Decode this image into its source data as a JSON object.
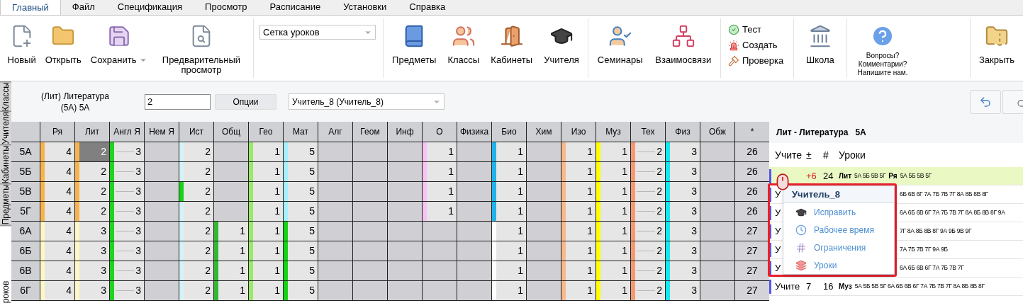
{
  "menu": [
    {
      "label": "Главный",
      "selected": true
    },
    {
      "label": "Файл",
      "selected": false
    },
    {
      "label": "Спецификация",
      "selected": false
    },
    {
      "label": "Просмотр",
      "selected": false
    },
    {
      "label": "Расписание",
      "selected": false
    },
    {
      "label": "Установки",
      "selected": false
    },
    {
      "label": "Справка",
      "selected": false
    }
  ],
  "ribbon": [
    {
      "kind": "buttons",
      "items": [
        {
          "label": "Новый",
          "dropdown": false
        },
        {
          "label": "Открыть",
          "dropdown": false
        },
        {
          "label": "Сохранить",
          "dropdown": true
        },
        {
          "label": "Предварительный просмотр",
          "dropdown": false
        }
      ]
    },
    {
      "kind": "select",
      "value": "Сетка уроков"
    },
    {
      "kind": "buttons",
      "items": [
        {
          "label": "Предметы",
          "dropdown": false
        },
        {
          "label": "Классы",
          "dropdown": false
        },
        {
          "label": "Кабинеты",
          "dropdown": false
        },
        {
          "label": "Учителя",
          "dropdown": false
        }
      ]
    },
    {
      "kind": "buttons",
      "items": [
        {
          "label": "Семинары",
          "dropdown": false
        },
        {
          "label": "Взаимосвязи",
          "dropdown": false
        }
      ]
    },
    {
      "kind": "list",
      "items": [
        {
          "label": "Тест"
        },
        {
          "label": "Создать"
        },
        {
          "label": "Проверка"
        }
      ]
    },
    {
      "kind": "buttons",
      "items": [
        {
          "label": "Школа",
          "dropdown": false
        }
      ]
    },
    {
      "kind": "note",
      "lines": [
        "Вопросы?",
        "Комментарии?",
        "Напишите нам."
      ]
    },
    {
      "kind": "buttons",
      "items": [
        {
          "label": "Закрыть",
          "dropdown": false
        }
      ]
    }
  ],
  "side_tabs": [
    {
      "label": "Классы",
      "selected": false
    },
    {
      "label": "Учителя",
      "selected": false
    },
    {
      "label": "Кабинеты",
      "selected": false
    },
    {
      "label": "Предметы",
      "selected": false
    },
    {
      "label": "роков",
      "selected": true
    }
  ],
  "options_bar": {
    "subject": "(Лит) Литература",
    "class": "(5А) 5А",
    "count": "2",
    "options_button": "Опции",
    "teacher": "Учитель_8 (Учитель_8)"
  },
  "grid": {
    "columns": [
      "Ря",
      "Лит",
      "Англ Я",
      "Нем Я",
      "Ист",
      "Общ",
      "Гео",
      "Мат",
      "Алг",
      "Геом",
      "Инф",
      "О",
      "Физика",
      "Био",
      "Хим",
      "Изо",
      "Муз",
      "Тех",
      "Физ",
      "Обж",
      "*"
    ],
    "rows": [
      {
        "label": "5А",
        "total": "26",
        "cells": [
          {
            "value": "4",
            "color": "#f7b44c",
            "linked": false,
            "selected": false
          },
          {
            "value": "2",
            "color": "#f7b44c",
            "linked": false,
            "selected": true
          },
          {
            "value": "3",
            "color": "#1ed41e",
            "linked": true,
            "selected": false
          },
          {
            "selected": false
          },
          {
            "value": "2",
            "color": "#d4f3f7",
            "linked": false,
            "selected": false
          },
          {
            "selected": false
          },
          {
            "value": "1",
            "color": "#9be86a",
            "linked": false,
            "selected": false
          },
          {
            "value": "5",
            "color": "#a6f0fa",
            "linked": false,
            "selected": false
          },
          {
            "selected": false
          },
          {
            "selected": false
          },
          {
            "selected": false
          },
          {
            "value": "1",
            "color": "#f7c3f2",
            "linked": false,
            "selected": false
          },
          {
            "selected": false
          },
          {
            "value": "1",
            "color": "#1fb3e8",
            "linked": false,
            "selected": false
          },
          {
            "selected": false
          },
          {
            "value": "1",
            "color": "#f8b98f",
            "linked": false,
            "selected": false
          },
          {
            "value": "1",
            "color": "#ffff00",
            "linked": false,
            "selected": false
          },
          {
            "value": "2",
            "color": "#f59a70",
            "linked": true,
            "selected": false
          },
          {
            "value": "3",
            "color": "#14e8ee",
            "linked": false,
            "selected": false
          },
          {
            "selected": false
          }
        ]
      },
      {
        "label": "5Б",
        "total": "26",
        "cells": [
          {
            "value": "4",
            "color": "#f7b44c",
            "linked": false,
            "selected": false
          },
          {
            "value": "2",
            "color": "#f7b44c",
            "linked": false,
            "selected": false
          },
          {
            "value": "3",
            "color": "#1ed41e",
            "linked": true,
            "selected": false
          },
          {
            "selected": false
          },
          {
            "value": "2",
            "color": "#d4f3f7",
            "linked": false,
            "selected": false
          },
          {
            "selected": false
          },
          {
            "value": "1",
            "color": "#9be86a",
            "linked": false,
            "selected": false
          },
          {
            "value": "5",
            "color": "#a6f0fa",
            "linked": false,
            "selected": false
          },
          {
            "selected": false
          },
          {
            "selected": false
          },
          {
            "selected": false
          },
          {
            "value": "1",
            "color": "#f7c3f2",
            "linked": false,
            "selected": false
          },
          {
            "selected": false
          },
          {
            "value": "1",
            "color": "#1fb3e8",
            "linked": false,
            "selected": false
          },
          {
            "selected": false
          },
          {
            "value": "1",
            "color": "#f8b98f",
            "linked": false,
            "selected": false
          },
          {
            "value": "1",
            "color": "#ffff00",
            "linked": false,
            "selected": false
          },
          {
            "value": "2",
            "color": "#f59a70",
            "linked": true,
            "selected": false
          },
          {
            "value": "3",
            "color": "#14e8ee",
            "linked": false,
            "selected": false
          },
          {
            "selected": false
          }
        ]
      },
      {
        "label": "5В",
        "total": "26",
        "cells": [
          {
            "value": "4",
            "color": "#f7b44c",
            "linked": false,
            "selected": false
          },
          {
            "value": "2",
            "color": "#f7b44c",
            "linked": false,
            "selected": false
          },
          {
            "value": "3",
            "color": "#1ed41e",
            "linked": true,
            "selected": false
          },
          {
            "selected": false
          },
          {
            "value": "2",
            "color": "#17d317",
            "linked": false,
            "selected": false
          },
          {
            "selected": false
          },
          {
            "value": "1",
            "color": "#9be86a",
            "linked": false,
            "selected": false
          },
          {
            "value": "5",
            "color": "#a6f0fa",
            "linked": false,
            "selected": false
          },
          {
            "selected": false
          },
          {
            "selected": false
          },
          {
            "selected": false
          },
          {
            "value": "1",
            "color": "#f7c3f2",
            "linked": false,
            "selected": false
          },
          {
            "selected": false
          },
          {
            "value": "1",
            "color": "#1fb3e8",
            "linked": false,
            "selected": false
          },
          {
            "selected": false
          },
          {
            "value": "1",
            "color": "#f8b98f",
            "linked": false,
            "selected": false
          },
          {
            "value": "1",
            "color": "#ffff00",
            "linked": false,
            "selected": false
          },
          {
            "value": "2",
            "color": "#f59a70",
            "linked": true,
            "selected": false
          },
          {
            "value": "3",
            "color": "#14e8ee",
            "linked": false,
            "selected": false
          },
          {
            "selected": false
          }
        ]
      },
      {
        "label": "5Г",
        "total": "26",
        "cells": [
          {
            "value": "4",
            "color": "#f7b44c",
            "linked": false,
            "selected": false
          },
          {
            "value": "2",
            "color": "#f7b44c",
            "linked": false,
            "selected": false
          },
          {
            "value": "3",
            "color": "#1ed41e",
            "linked": true,
            "selected": false
          },
          {
            "selected": false
          },
          {
            "value": "2",
            "color": "#d4f3f7",
            "linked": false,
            "selected": false
          },
          {
            "selected": false
          },
          {
            "value": "1",
            "color": "#9be86a",
            "linked": false,
            "selected": false
          },
          {
            "value": "5",
            "color": "#a6f0fa",
            "linked": false,
            "selected": false
          },
          {
            "selected": false
          },
          {
            "selected": false
          },
          {
            "selected": false
          },
          {
            "value": "1",
            "color": "#f7c3f2",
            "linked": false,
            "selected": false
          },
          {
            "selected": false
          },
          {
            "value": "1",
            "color": "#1fb3e8",
            "linked": false,
            "selected": false
          },
          {
            "selected": false
          },
          {
            "value": "1",
            "color": "#f8b98f",
            "linked": false,
            "selected": false
          },
          {
            "value": "1",
            "color": "#ffff00",
            "linked": false,
            "selected": false
          },
          {
            "value": "2",
            "color": "#f59a70",
            "linked": true,
            "selected": false
          },
          {
            "value": "3",
            "color": "#14e8ee",
            "linked": false,
            "selected": false
          },
          {
            "selected": false
          }
        ]
      },
      {
        "label": "6А",
        "total": "27",
        "cells": [
          {
            "value": "4",
            "color": "#fdf7c4",
            "linked": false,
            "selected": false
          },
          {
            "value": "3",
            "color": "#fdf7c4",
            "linked": false,
            "selected": false
          },
          {
            "value": "3",
            "color": "#1ed41e",
            "linked": true,
            "selected": false
          },
          {
            "selected": false
          },
          {
            "value": "2",
            "color": "#d4f3f7",
            "linked": false,
            "selected": false
          },
          {
            "value": "1",
            "color": "#33b833",
            "linked": false,
            "selected": false
          },
          {
            "value": "1",
            "color": "#9be86a",
            "linked": false,
            "selected": false
          },
          {
            "value": "5",
            "color": "#17d317",
            "linked": false,
            "selected": false
          },
          {
            "selected": false
          },
          {
            "selected": false
          },
          {
            "selected": false
          },
          {
            "selected": false
          },
          {
            "selected": false
          },
          {
            "value": "1",
            "color": "#ffffff",
            "linked": false,
            "selected": false
          },
          {
            "selected": false
          },
          {
            "value": "1",
            "color": "#f8b98f",
            "linked": false,
            "selected": false
          },
          {
            "value": "1",
            "color": "#ffff00",
            "linked": false,
            "selected": false
          },
          {
            "value": "2",
            "color": "#f59a70",
            "linked": true,
            "selected": false
          },
          {
            "value": "3",
            "color": "#14e8ee",
            "linked": false,
            "selected": false
          },
          {
            "selected": false
          }
        ]
      },
      {
        "label": "6Б",
        "total": "27",
        "cells": [
          {
            "value": "4",
            "color": "#fdf7c4",
            "linked": false,
            "selected": false
          },
          {
            "value": "3",
            "color": "#fdf7c4",
            "linked": false,
            "selected": false
          },
          {
            "value": "3",
            "color": "#1ed41e",
            "linked": true,
            "selected": false
          },
          {
            "selected": false
          },
          {
            "value": "2",
            "color": "#d4f3f7",
            "linked": false,
            "selected": false
          },
          {
            "value": "1",
            "color": "#33b833",
            "linked": false,
            "selected": false
          },
          {
            "value": "1",
            "color": "#9be86a",
            "linked": false,
            "selected": false
          },
          {
            "value": "5",
            "color": "#17d317",
            "linked": false,
            "selected": false
          },
          {
            "selected": false
          },
          {
            "selected": false
          },
          {
            "selected": false
          },
          {
            "selected": false
          },
          {
            "selected": false
          },
          {
            "value": "1",
            "color": "#ffffff",
            "linked": false,
            "selected": false
          },
          {
            "selected": false
          },
          {
            "value": "1",
            "color": "#f8b98f",
            "linked": false,
            "selected": false
          },
          {
            "value": "1",
            "color": "#ffff00",
            "linked": false,
            "selected": false
          },
          {
            "value": "2",
            "color": "#f59a70",
            "linked": true,
            "selected": false
          },
          {
            "value": "3",
            "color": "#14e8ee",
            "linked": false,
            "selected": false
          },
          {
            "selected": false
          }
        ]
      },
      {
        "label": "6В",
        "total": "27",
        "cells": [
          {
            "value": "4",
            "color": "#fdf7c4",
            "linked": false,
            "selected": false
          },
          {
            "value": "3",
            "color": "#fdf7c4",
            "linked": false,
            "selected": false
          },
          {
            "value": "3",
            "color": "#1ed41e",
            "linked": true,
            "selected": false
          },
          {
            "selected": false
          },
          {
            "value": "2",
            "color": "#d4f3f7",
            "linked": false,
            "selected": false
          },
          {
            "value": "1",
            "color": "#33b833",
            "linked": false,
            "selected": false
          },
          {
            "value": "1",
            "color": "#9be86a",
            "linked": false,
            "selected": false
          },
          {
            "value": "5",
            "color": "#17d317",
            "linked": false,
            "selected": false
          },
          {
            "selected": false
          },
          {
            "selected": false
          },
          {
            "selected": false
          },
          {
            "selected": false
          },
          {
            "selected": false
          },
          {
            "value": "1",
            "color": "#ffffff",
            "linked": false,
            "selected": false
          },
          {
            "selected": false
          },
          {
            "value": "1",
            "color": "#f8b98f",
            "linked": false,
            "selected": false
          },
          {
            "value": "1",
            "color": "#ffff00",
            "linked": false,
            "selected": false
          },
          {
            "value": "2",
            "color": "#f59a70",
            "linked": true,
            "selected": false
          },
          {
            "value": "3",
            "color": "#14e8ee",
            "linked": false,
            "selected": false
          },
          {
            "selected": false
          }
        ]
      },
      {
        "label": "6Г",
        "total": "27",
        "cells": [
          {
            "value": "4",
            "color": "#fdf7c4",
            "linked": false,
            "selected": false
          },
          {
            "value": "3",
            "color": "#fdf7c4",
            "linked": false,
            "selected": false
          },
          {
            "value": "3",
            "color": "#1ed41e",
            "linked": true,
            "selected": false
          },
          {
            "selected": false
          },
          {
            "value": "2",
            "color": "#d4f3f7",
            "linked": false,
            "selected": false
          },
          {
            "value": "1",
            "color": "#33b833",
            "linked": false,
            "selected": false
          },
          {
            "value": "1",
            "color": "#9be86a",
            "linked": false,
            "selected": false
          },
          {
            "value": "5",
            "color": "#17d317",
            "linked": false,
            "selected": false
          },
          {
            "selected": false
          },
          {
            "selected": false
          },
          {
            "selected": false
          },
          {
            "selected": false
          },
          {
            "selected": false
          },
          {
            "value": "1",
            "color": "#ffffff",
            "linked": false,
            "selected": false
          },
          {
            "selected": false
          },
          {
            "value": "1",
            "color": "#f8b98f",
            "linked": false,
            "selected": false
          },
          {
            "value": "1",
            "color": "#ffff00",
            "linked": false,
            "selected": false
          },
          {
            "value": "2",
            "color": "#f59a70",
            "linked": true,
            "selected": false
          },
          {
            "value": "3",
            "color": "#14e8ee",
            "linked": false,
            "selected": false
          },
          {
            "selected": false
          }
        ]
      }
    ]
  },
  "panel": {
    "subject": "Лит - Литература",
    "class": "5А",
    "columns": [
      "Учите",
      "±",
      "#",
      "Уроки"
    ],
    "rows": [
      {
        "delta": "+6",
        "count": "24",
        "selected": true,
        "lessons": [
          {
            "subject": "Лит",
            "classes": "5А 5Б 5В 5Г"
          },
          {
            "subject": "Ря",
            "classes": "5А 5Б 5В 5Г"
          }
        ]
      },
      {
        "name": "У",
        "classes": "6Б 6В 6Г 7А 7Б 7В 7Г 8А 8Б 8В 8Г",
        "selected": false
      },
      {
        "name": "У",
        "classes": "6А 6Б 6В 6Г 7А 7Б 7В 7Г 8А 8Б 8В 8Г 9А",
        "selected": false
      },
      {
        "name": "У",
        "classes": "7Г 8А 8Б 8В 8Г 9А 9Б 9В 9Г",
        "selected": false
      },
      {
        "name": "У",
        "classes": "7А 7Б 7В 7Г 9А 9Б",
        "selected": false
      },
      {
        "name": "У",
        "classes": "6А 6Б 6В 6Г 7А 7Б 7В 7Г",
        "selected": false
      },
      {
        "name": "Учите",
        "delta": "7",
        "count": "16",
        "selected": false,
        "lessons": [
          {
            "subject": "Муз",
            "classes": "5А 5Б 5В 5Г 6А 6Б 6В 6Г 7А 7Б 7В 7Г 8А 8Б 8В 8Г"
          }
        ]
      }
    ]
  },
  "context_menu": {
    "title": "Учитель_8",
    "items": [
      {
        "label": "Исправить"
      },
      {
        "label": "Рабочее время"
      },
      {
        "label": "Ограничения"
      },
      {
        "label": "Уроки"
      }
    ]
  }
}
